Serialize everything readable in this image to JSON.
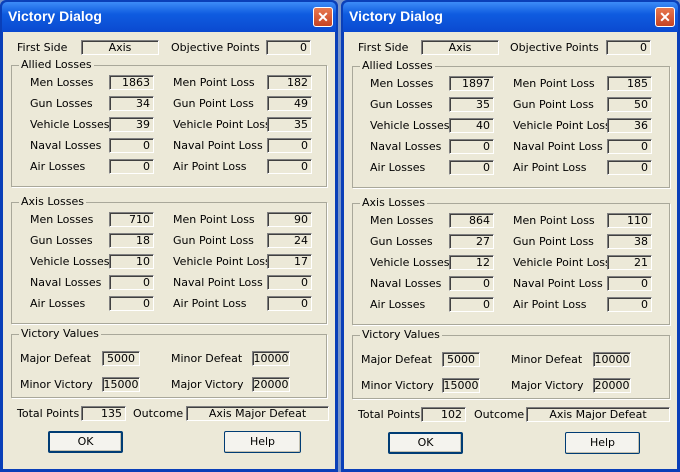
{
  "dialogs": [
    {
      "title": "Victory Dialog",
      "close_glyph": "✕",
      "first_side_label": "First Side",
      "first_side": "Axis",
      "objective_points_label": "Objective Points",
      "objective_points": "0",
      "allied": {
        "title": "Allied Losses",
        "men_label": "Men Losses",
        "men": "1863",
        "gun_label": "Gun Losses",
        "gun": "34",
        "vehicle_label": "Vehicle Losses",
        "vehicle": "39",
        "naval_label": "Naval Losses",
        "naval": "0",
        "air_label": "Air Losses",
        "air": "0",
        "men_pt_label": "Men Point Loss",
        "men_pt": "182",
        "gun_pt_label": "Gun Point Loss",
        "gun_pt": "49",
        "vehicle_pt_label": "Vehicle Point Loss",
        "vehicle_pt": "35",
        "naval_pt_label": "Naval Point Loss",
        "naval_pt": "0",
        "air_pt_label": "Air Point Loss",
        "air_pt": "0"
      },
      "axis": {
        "title": "Axis Losses",
        "men_label": "Men Losses",
        "men": "710",
        "gun_label": "Gun Losses",
        "gun": "18",
        "vehicle_label": "Vehicle Losses",
        "vehicle": "10",
        "naval_label": "Naval Losses",
        "naval": "0",
        "air_label": "Air Losses",
        "air": "0",
        "men_pt_label": "Men Point Loss",
        "men_pt": "90",
        "gun_pt_label": "Gun Point Loss",
        "gun_pt": "24",
        "vehicle_pt_label": "Vehicle Point Loss",
        "vehicle_pt": "17",
        "naval_pt_label": "Naval Point Loss",
        "naval_pt": "0",
        "air_pt_label": "Air Point Loss",
        "air_pt": "0"
      },
      "victory": {
        "title": "Victory Values",
        "major_defeat_label": "Major Defeat",
        "major_defeat": "5000",
        "minor_defeat_label": "Minor Defeat",
        "minor_defeat": "10000",
        "minor_victory_label": "Minor Victory",
        "minor_victory": "15000",
        "major_victory_label": "Major Victory",
        "major_victory": "20000"
      },
      "total_points_label": "Total Points",
      "total_points": "135",
      "outcome_label": "Outcome",
      "outcome": "Axis Major Defeat",
      "ok_label": "OK",
      "help_label": "Help"
    },
    {
      "title": "Victory Dialog",
      "close_glyph": "✕",
      "first_side_label": "First Side",
      "first_side": "Axis",
      "objective_points_label": "Objective Points",
      "objective_points": "0",
      "allied": {
        "title": "Allied Losses",
        "men_label": "Men Losses",
        "men": "1897",
        "gun_label": "Gun Losses",
        "gun": "35",
        "vehicle_label": "Vehicle Losses",
        "vehicle": "40",
        "naval_label": "Naval Losses",
        "naval": "0",
        "air_label": "Air Losses",
        "air": "0",
        "men_pt_label": "Men Point Loss",
        "men_pt": "185",
        "gun_pt_label": "Gun Point Loss",
        "gun_pt": "50",
        "vehicle_pt_label": "Vehicle Point Loss",
        "vehicle_pt": "36",
        "naval_pt_label": "Naval Point Loss",
        "naval_pt": "0",
        "air_pt_label": "Air Point Loss",
        "air_pt": "0"
      },
      "axis": {
        "title": "Axis Losses",
        "men_label": "Men Losses",
        "men": "864",
        "gun_label": "Gun Losses",
        "gun": "27",
        "vehicle_label": "Vehicle Losses",
        "vehicle": "12",
        "naval_label": "Naval Losses",
        "naval": "0",
        "air_label": "Air Losses",
        "air": "0",
        "men_pt_label": "Men Point Loss",
        "men_pt": "110",
        "gun_pt_label": "Gun Point Loss",
        "gun_pt": "38",
        "vehicle_pt_label": "Vehicle Point Loss",
        "vehicle_pt": "21",
        "naval_pt_label": "Naval Point Loss",
        "naval_pt": "0",
        "air_pt_label": "Air Point Loss",
        "air_pt": "0"
      },
      "victory": {
        "title": "Victory Values",
        "major_defeat_label": "Major Defeat",
        "major_defeat": "5000",
        "minor_defeat_label": "Minor Defeat",
        "minor_defeat": "10000",
        "minor_victory_label": "Minor Victory",
        "minor_victory": "15000",
        "major_victory_label": "Major Victory",
        "major_victory": "20000"
      },
      "total_points_label": "Total Points",
      "total_points": "102",
      "outcome_label": "Outcome",
      "outcome": "Axis Major Defeat",
      "ok_label": "OK",
      "help_label": "Help"
    }
  ]
}
